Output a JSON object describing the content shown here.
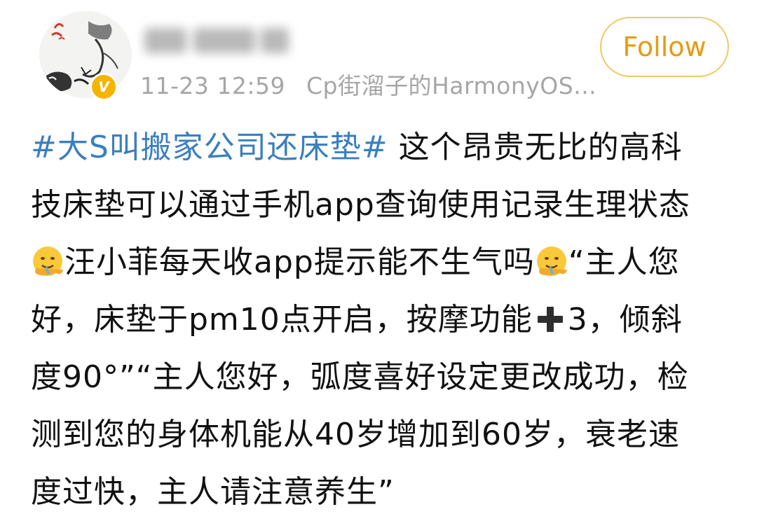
{
  "author": {
    "username": "",
    "verified_badge": "V",
    "timestamp": "11-23 12:59",
    "source": "Cp街溜子的HarmonyOS..."
  },
  "follow_button": {
    "label": "Follow"
  },
  "post": {
    "hashtag": "#大S叫搬家公司还床垫#",
    "line1_rest": "这个昂贵无比的高科",
    "line2": "技床垫可以通过手机app查询使用记录生理状态",
    "line3_text": "汪小菲每天收app提示能不生气吗",
    "line3_tail": "“主人您",
    "line4_head": "好，床垫于pm10点开启，按摩功能",
    "line4_tail": "3，倾斜",
    "line5": "度90°”“主人您好，弧度喜好设定更改成功，检",
    "line6": "测到您的身体机能从40岁增加到60岁，衰老速",
    "line7": "度过快，主人请注意养生”"
  },
  "icons": {
    "emoji": "drooling-face-emoji",
    "plus": "heavy-plus-icon",
    "avatar": "cat-sketch-avatar",
    "badge": "verified-v-icon"
  },
  "colors": {
    "hashtag": "#3a7fc0",
    "follow_text": "#e89a10",
    "follow_border": "#f0c868",
    "meta_text": "#a6a6a6",
    "badge": "#f5b400"
  }
}
